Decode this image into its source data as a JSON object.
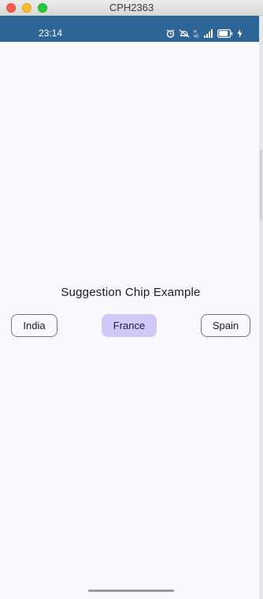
{
  "window": {
    "title": "CPH2363"
  },
  "statusbar": {
    "time": "23:14",
    "icons": [
      "alarm-icon",
      "mute-icon",
      "volte-icon",
      "signal-icon",
      "battery-icon",
      "charging-icon"
    ]
  },
  "main": {
    "title": "Suggestion Chip Example",
    "chips": [
      {
        "label": "India",
        "selected": false
      },
      {
        "label": "France",
        "selected": true
      },
      {
        "label": "Spain",
        "selected": false
      }
    ]
  },
  "colors": {
    "statusbar": "#2c6596",
    "background": "#fbf8fd",
    "chip_selected": "#d0c8f6",
    "chip_outline": "#79747e"
  }
}
